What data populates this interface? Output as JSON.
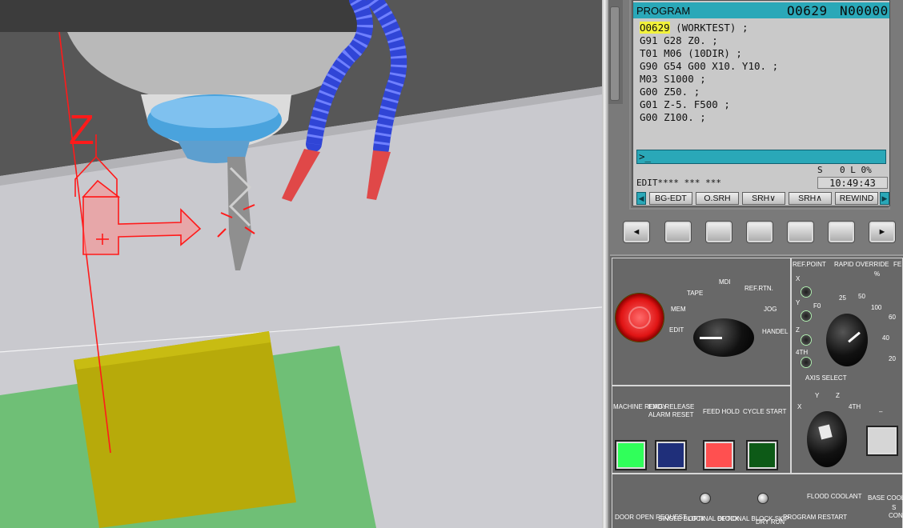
{
  "program_screen": {
    "title": "PROGRAM",
    "program_number": "O0629",
    "sequence_number": "N00000",
    "lines": [
      {
        "highlight": "O0629",
        "rest": " (WORKTEST) ;"
      },
      {
        "highlight": "",
        "rest": "G91 G28 Z0. ;"
      },
      {
        "highlight": "",
        "rest": "T01 M06 (10DIR) ;"
      },
      {
        "highlight": "",
        "rest": "G90 G54 G00 X10. Y10. ;"
      },
      {
        "highlight": "",
        "rest": "M03 S1000 ;"
      },
      {
        "highlight": "",
        "rest": "G00 Z50. ;"
      },
      {
        "highlight": "",
        "rest": "G01 Z-5. F500 ;"
      },
      {
        "highlight": "",
        "rest": "G00 Z100. ;"
      }
    ],
    "input_prompt": ">_",
    "status_s": "S",
    "status_values": "0 L 0%",
    "mode_text": "EDIT**** ***      ***",
    "clock": "10:49:43",
    "soft_keys": [
      "BG-EDT",
      "O.SRH",
      "SRH∨",
      "SRH∧",
      "REWIND"
    ],
    "accent_color": "#2aa8b8"
  },
  "physical_keys": [
    "◄",
    "",
    "",
    "",
    "",
    "",
    "►"
  ],
  "operator_panel": {
    "mode_labels": {
      "mdi": "MDI",
      "tape": "TAPE",
      "ref_rtn": "REF.RTN.",
      "mem": "MEM",
      "jog": "JOG",
      "edit": "EDIT",
      "handel": "HANDEL"
    },
    "ref_point": "REF.POINT",
    "rapid_override": "RAPID OVERRIDE",
    "rapid_unit": "%",
    "axis_leds": [
      "X",
      "Y",
      "Z",
      "4TH"
    ],
    "rapid_values": [
      "F0",
      "25",
      "50",
      "100"
    ],
    "feed_values": [
      "60",
      "40",
      "20"
    ],
    "fe_label": "FE",
    "axis_select": "AXIS SELECT",
    "axis_select_values": [
      "X",
      "Y",
      "Z",
      "4TH"
    ],
    "axis_minus": "–",
    "machine_ready": "MACHINE READY",
    "emg_release": "EMG.RELEASE",
    "alarm_reset": "ALARM RESET",
    "feed_hold": "FEED HOLD",
    "cycle_start": "CYCLE START",
    "bottom_labels": [
      "DOOR OPEN REQUEST",
      "SINGLE BLOCK",
      "OPTINAL BLOCK",
      "OPTIONAL BLOCK SKIP",
      "DRY RUN",
      "PROGRAM RESTART",
      "FLOOD COOLANT",
      "BASE COOLANT"
    ],
    "bottom_partial": [
      "S",
      "CON"
    ],
    "button_colors": {
      "machine_ready": "#30ff5a",
      "alarm_reset": "#1f2f7a",
      "feed_hold": "#ff5050",
      "cycle_start": "#0d5a17"
    }
  },
  "viewport_axes": {
    "z_label": "Z"
  }
}
